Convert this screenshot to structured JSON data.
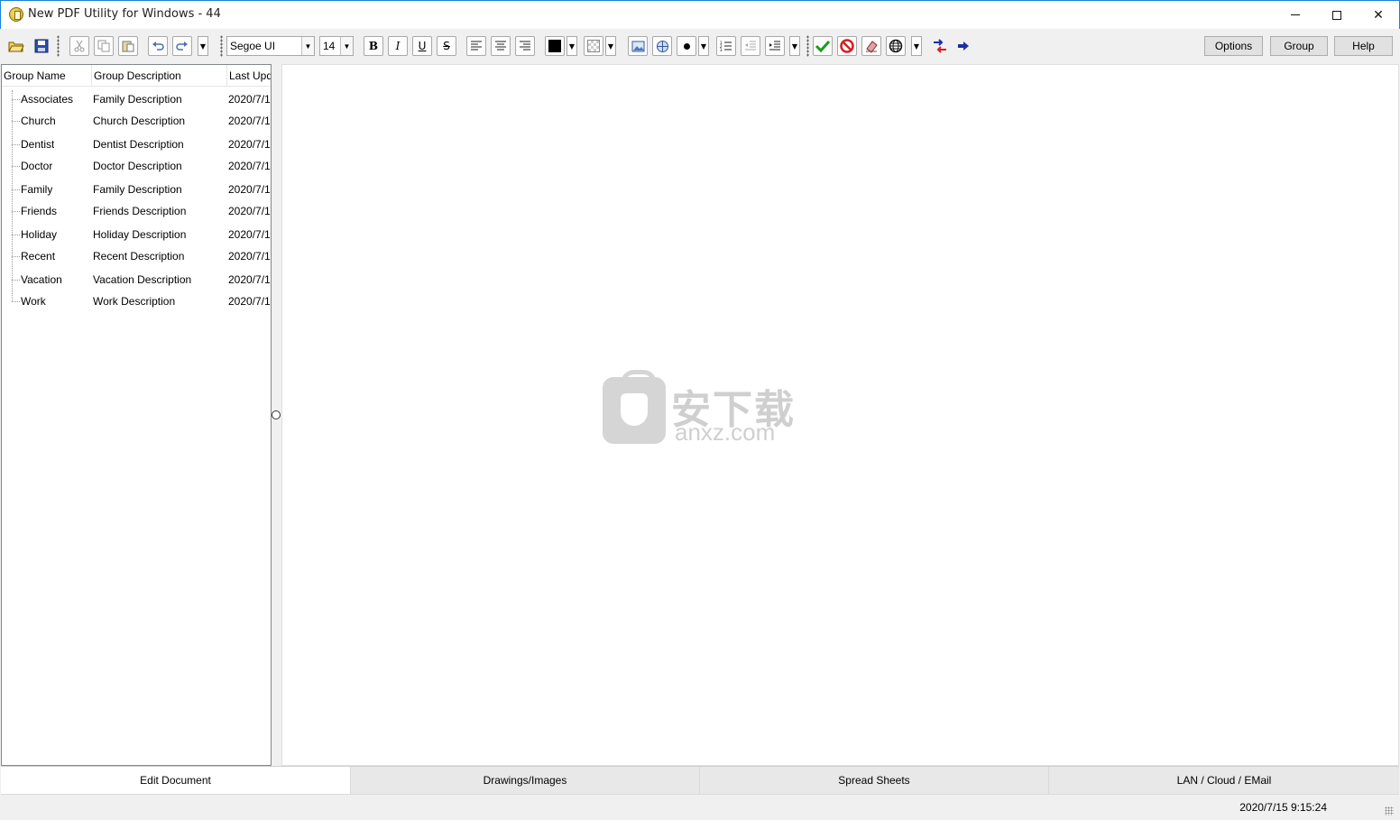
{
  "window": {
    "title": "New PDF Utility for Windows - 44",
    "minimize_glyph": "",
    "close_glyph": "✕"
  },
  "toolbar": {
    "font_name": "Segoe UI",
    "font_size": "14",
    "bold_label": "B",
    "italic_label": "I",
    "underline_label": "U",
    "strike_label": "S",
    "options_label": "Options",
    "group_label": "Group",
    "help_label": "Help",
    "icons": [
      "open-folder-icon",
      "save-icon",
      "cut-icon",
      "copy-icon",
      "paste-icon",
      "undo-icon",
      "redo-icon",
      "align-left-icon",
      "align-center-icon",
      "align-right-icon",
      "font-color-icon",
      "background-color-icon",
      "insert-image-icon",
      "insert-link-icon",
      "bullet-icon",
      "numbered-list-icon",
      "outdent-icon",
      "indent-icon",
      "check-icon",
      "cancel-icon",
      "eraser-icon",
      "globe-icon",
      "swap-icon",
      "arrow-right-icon"
    ],
    "accent_green": "#1a9c1a",
    "accent_red": "#d42020",
    "accent_blue": "#1a2fa8"
  },
  "group_list": {
    "columns": [
      "Group Name",
      "Group Description",
      "Last Upd"
    ],
    "rows": [
      {
        "name": "Associates",
        "description": "Family Description",
        "last_updated": "2020/7/1"
      },
      {
        "name": "Church",
        "description": "Church Description",
        "last_updated": "2020/7/1"
      },
      {
        "name": "Dentist",
        "description": "Dentist Description",
        "last_updated": "2020/7/1"
      },
      {
        "name": "Doctor",
        "description": "Doctor Description",
        "last_updated": "2020/7/1"
      },
      {
        "name": "Family",
        "description": "Family Description",
        "last_updated": "2020/7/1"
      },
      {
        "name": "Friends",
        "description": "Friends Description",
        "last_updated": "2020/7/1"
      },
      {
        "name": "Holiday",
        "description": "Holiday Description",
        "last_updated": "2020/7/1"
      },
      {
        "name": "Recent",
        "description": "Recent Description",
        "last_updated": "2020/7/1"
      },
      {
        "name": "Vacation",
        "description": "Vacation Description",
        "last_updated": "2020/7/1"
      },
      {
        "name": "Work",
        "description": "Work Description",
        "last_updated": "2020/7/1"
      }
    ]
  },
  "watermark": {
    "cn": "安下载",
    "en": "anxz.com"
  },
  "tabs": [
    {
      "label": "Edit Document",
      "active": true
    },
    {
      "label": "Drawings/Images",
      "active": false
    },
    {
      "label": "Spread Sheets",
      "active": false
    },
    {
      "label": "LAN / Cloud / EMail",
      "active": false
    }
  ],
  "status": {
    "datetime": "2020/7/15 9:15:24"
  }
}
